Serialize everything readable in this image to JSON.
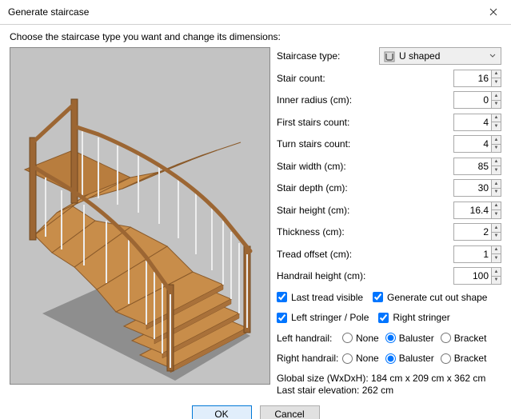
{
  "window": {
    "title": "Generate staircase"
  },
  "instruction": "Choose the staircase type you want and change its dimensions:",
  "labels": {
    "type": "Staircase type:",
    "stairCount": "Stair count:",
    "innerRadius": "Inner radius (cm):",
    "firstStairs": "First stairs count:",
    "turnStairs": "Turn stairs count:",
    "stairWidth": "Stair width (cm):",
    "stairDepth": "Stair depth (cm):",
    "stairHeight": "Stair height (cm):",
    "thickness": "Thickness (cm):",
    "treadOffset": "Tread offset (cm):",
    "handrailHeight": "Handrail height (cm):",
    "lastTread": "Last tread visible",
    "cutOut": "Generate cut out shape",
    "leftStringer": "Left stringer / Pole",
    "rightStringer": "Right stringer",
    "leftHandrail": "Left handrail:",
    "rightHandrail": "Right handrail:",
    "none": "None",
    "baluster": "Baluster",
    "bracket": "Bracket"
  },
  "values": {
    "type": "U shaped",
    "stairCount": "16",
    "innerRadius": "0",
    "firstStairs": "4",
    "turnStairs": "4",
    "stairWidth": "85",
    "stairDepth": "30",
    "stairHeight": "16.4",
    "thickness": "2",
    "treadOffset": "1",
    "handrailHeight": "100"
  },
  "checks": {
    "lastTread": true,
    "cutOut": true,
    "leftStringer": true,
    "rightStringer": true
  },
  "radios": {
    "left": "Baluster",
    "right": "Baluster"
  },
  "info": {
    "line1": "Global size (WxDxH): 184 cm x 209 cm x 362 cm",
    "line2": "Last stair elevation: 262 cm"
  },
  "buttons": {
    "ok": "OK",
    "cancel": "Cancel"
  }
}
